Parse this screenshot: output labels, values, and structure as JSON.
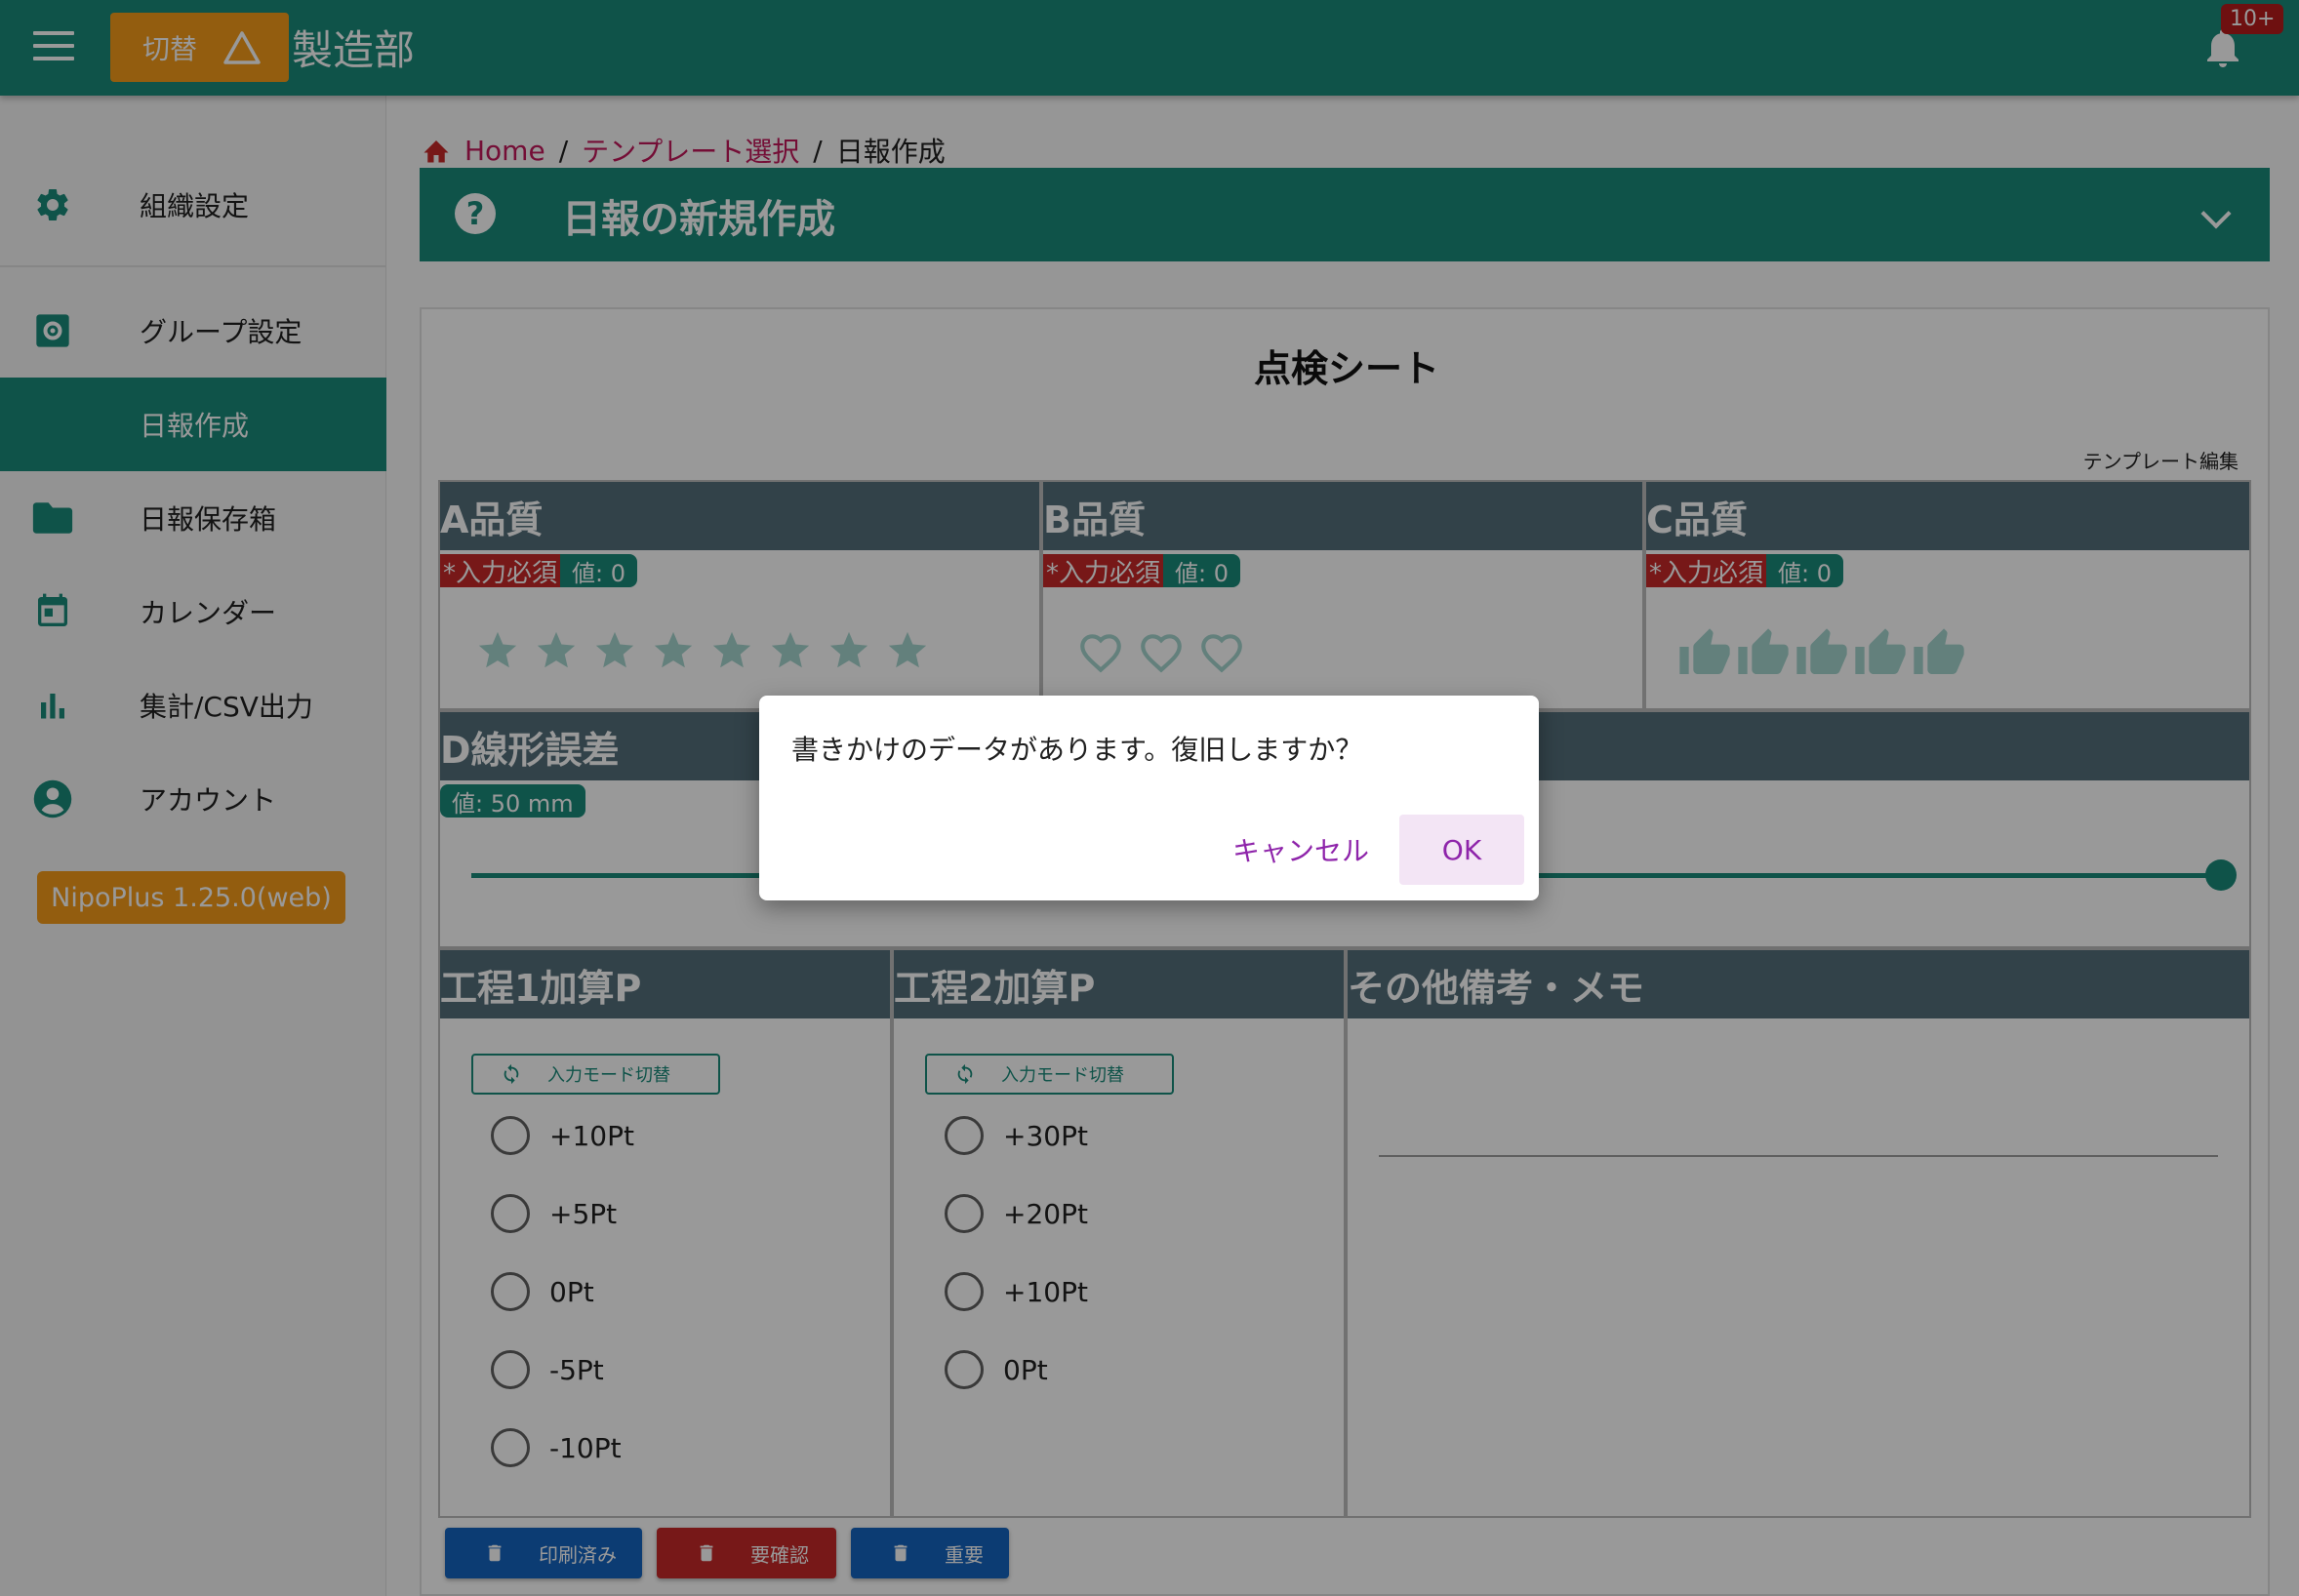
{
  "appbar": {
    "switch_label": "切替",
    "dept_title": "製造部",
    "notification_badge": "10+"
  },
  "sidebar": {
    "items": [
      {
        "label": "組織設定",
        "icon": "gear-icon"
      },
      {
        "label": "グループ設定",
        "icon": "settings-box-icon"
      },
      {
        "label": "日報作成",
        "icon": ""
      },
      {
        "label": "日報保存箱",
        "icon": "folder-icon"
      },
      {
        "label": "カレンダー",
        "icon": "calendar-icon"
      },
      {
        "label": "集計/CSV出力",
        "icon": "bar-chart-icon"
      },
      {
        "label": "アカウント",
        "icon": "account-circle-icon"
      }
    ],
    "version": "NipoPlus 1.25.0(web)"
  },
  "breadcrumb": {
    "home": "Home",
    "sep": "/",
    "template_select": "テンプレート選択",
    "current": "日報作成"
  },
  "header": {
    "title": "日報の新規作成",
    "help": "?"
  },
  "sheet": {
    "title": "点検シート",
    "template_edit": "テンプレート編集",
    "required_label": "*入力必須",
    "fields": {
      "a": {
        "label": "A品質",
        "value": "値: 0",
        "rating_max": 8,
        "icon": "star-icon"
      },
      "b": {
        "label": "B品質",
        "value": "値: 0",
        "rating_max": 3,
        "icon": "heart-icon"
      },
      "c": {
        "label": "C品質",
        "value": "値: 0",
        "rating_max": 5,
        "icon": "thumb-up-icon"
      },
      "d": {
        "label": "D線形誤差",
        "value": "値: 50 mm"
      },
      "p1": {
        "label": "工程1加算P",
        "mode_button": "入力モード切替",
        "options": [
          "+10Pt",
          "+5Pt",
          "0Pt",
          "-5Pt",
          "-10Pt"
        ]
      },
      "p2": {
        "label": "工程2加算P",
        "mode_button": "入力モード切替",
        "options": [
          "+30Pt",
          "+20Pt",
          "+10Pt",
          "0Pt"
        ]
      },
      "memo": {
        "label": "その他備考・メモ"
      }
    }
  },
  "footer_buttons": [
    {
      "label": "印刷済み",
      "color": "#1565c0"
    },
    {
      "label": "要確認",
      "color": "#c62828"
    },
    {
      "label": "重要",
      "color": "#1565c0"
    }
  ],
  "dialog": {
    "message": "書きかけのデータがあります。復旧しますか？",
    "cancel": "キャンセル",
    "ok": "OK"
  },
  "colors": {
    "primary": "#1a8b7b",
    "accent": "#f59c1a",
    "header_dark": "#546e7a",
    "required": "#c62828",
    "dialog_action": "#8e24aa"
  }
}
